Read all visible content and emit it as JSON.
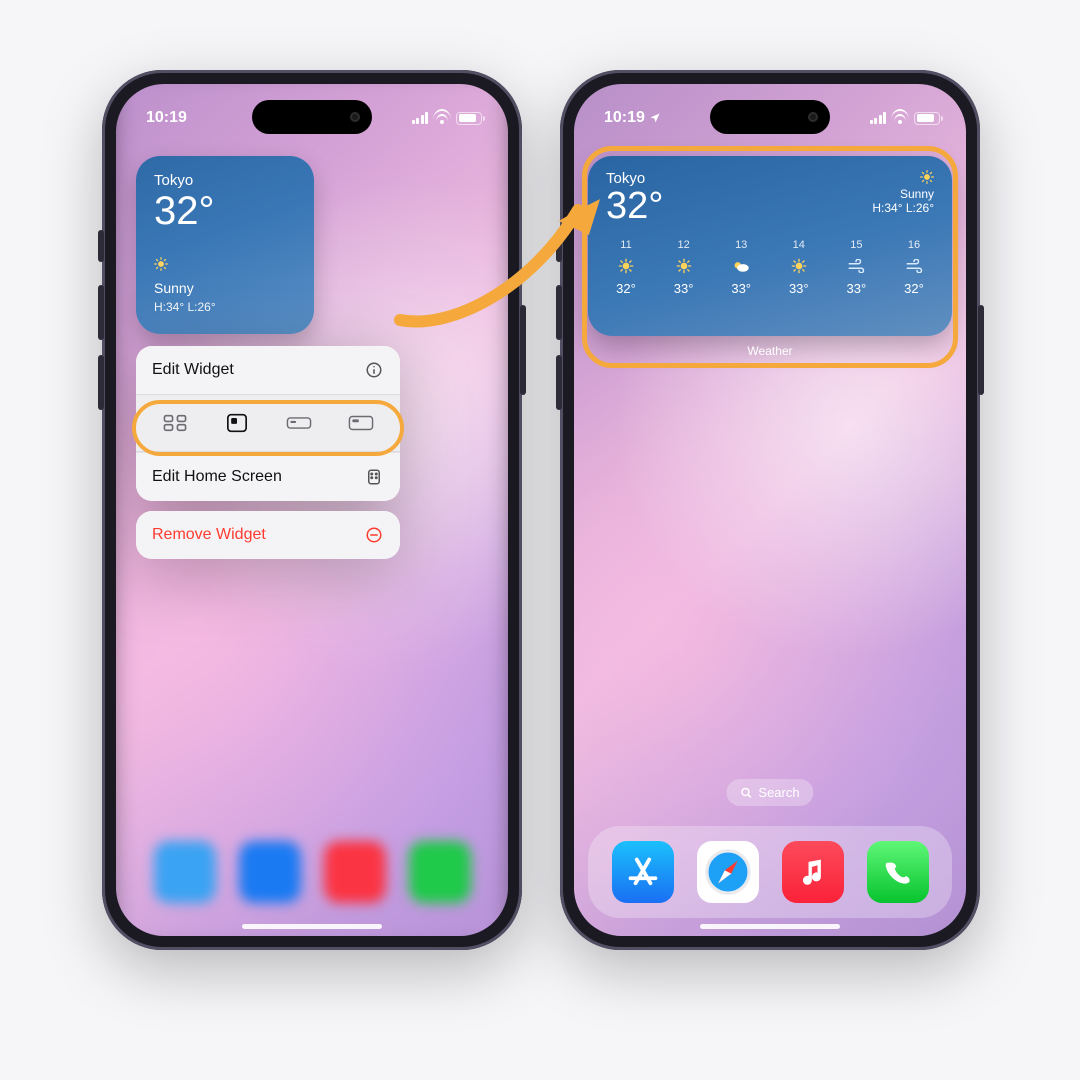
{
  "statusbar": {
    "time": "10:19"
  },
  "colors": {
    "highlight": "#f5a93c",
    "danger": "#ff3b30"
  },
  "left": {
    "widget": {
      "city": "Tokyo",
      "temp": "32°",
      "condition": "Sunny",
      "hilo": "H:34° L:26°"
    },
    "menu": {
      "edit_widget": "Edit Widget",
      "edit_home": "Edit Home Screen",
      "remove_widget": "Remove Widget",
      "sizes": [
        "app-grid",
        "small",
        "medium-thin",
        "medium"
      ],
      "selected_size_index": 1
    }
  },
  "right": {
    "widget": {
      "city": "Tokyo",
      "temp": "32°",
      "condition": "Sunny",
      "hilo": "H:34° L:26°",
      "label": "Weather",
      "hourly": [
        {
          "hour": "11",
          "icon": "sunny",
          "temp": "32°"
        },
        {
          "hour": "12",
          "icon": "sunny",
          "temp": "33°"
        },
        {
          "hour": "13",
          "icon": "cloudy",
          "temp": "33°"
        },
        {
          "hour": "14",
          "icon": "sunny",
          "temp": "33°"
        },
        {
          "hour": "15",
          "icon": "wind",
          "temp": "33°"
        },
        {
          "hour": "16",
          "icon": "wind",
          "temp": "32°"
        }
      ]
    },
    "search_label": "Search",
    "dock": [
      "App Store",
      "Safari",
      "Music",
      "Phone"
    ]
  }
}
